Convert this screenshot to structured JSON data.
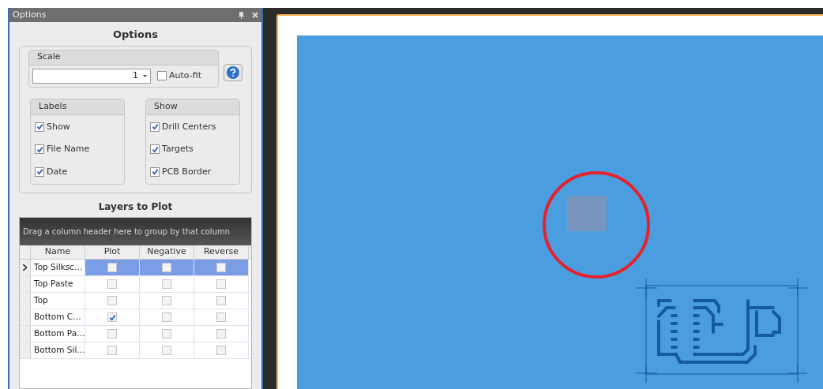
{
  "panel": {
    "title": "Options",
    "heading": "Options"
  },
  "scale": {
    "label": "Scale",
    "value": "1",
    "autofit": {
      "label": "Auto-fit",
      "checked": false
    }
  },
  "labels": {
    "label": "Labels",
    "items": [
      {
        "label": "Show",
        "checked": true
      },
      {
        "label": "File Name",
        "checked": true
      },
      {
        "label": "Date",
        "checked": true
      }
    ]
  },
  "show": {
    "label": "Show",
    "items": [
      {
        "label": "Drill Centers",
        "checked": true
      },
      {
        "label": "Targets",
        "checked": true
      },
      {
        "label": "PCB Border",
        "checked": true
      }
    ]
  },
  "layers": {
    "heading": "Layers to Plot",
    "group_hint": "Drag a column header here to group by that column",
    "columns": [
      "Name",
      "Plot",
      "Negative",
      "Reverse"
    ],
    "rows": [
      {
        "name": "Top Silksc…",
        "selected": true,
        "plot": false,
        "negative": false,
        "reverse": false
      },
      {
        "name": "Top Paste",
        "selected": false,
        "plot": false,
        "negative": false,
        "reverse": false
      },
      {
        "name": "Top",
        "selected": false,
        "plot": false,
        "negative": false,
        "reverse": false
      },
      {
        "name": "Bottom C…",
        "selected": false,
        "plot": true,
        "negative": false,
        "reverse": false
      },
      {
        "name": "Bottom Pa…",
        "selected": false,
        "plot": false,
        "negative": false,
        "reverse": false
      },
      {
        "name": "Bottom Sil…",
        "selected": false,
        "plot": false,
        "negative": false,
        "reverse": false
      }
    ]
  }
}
